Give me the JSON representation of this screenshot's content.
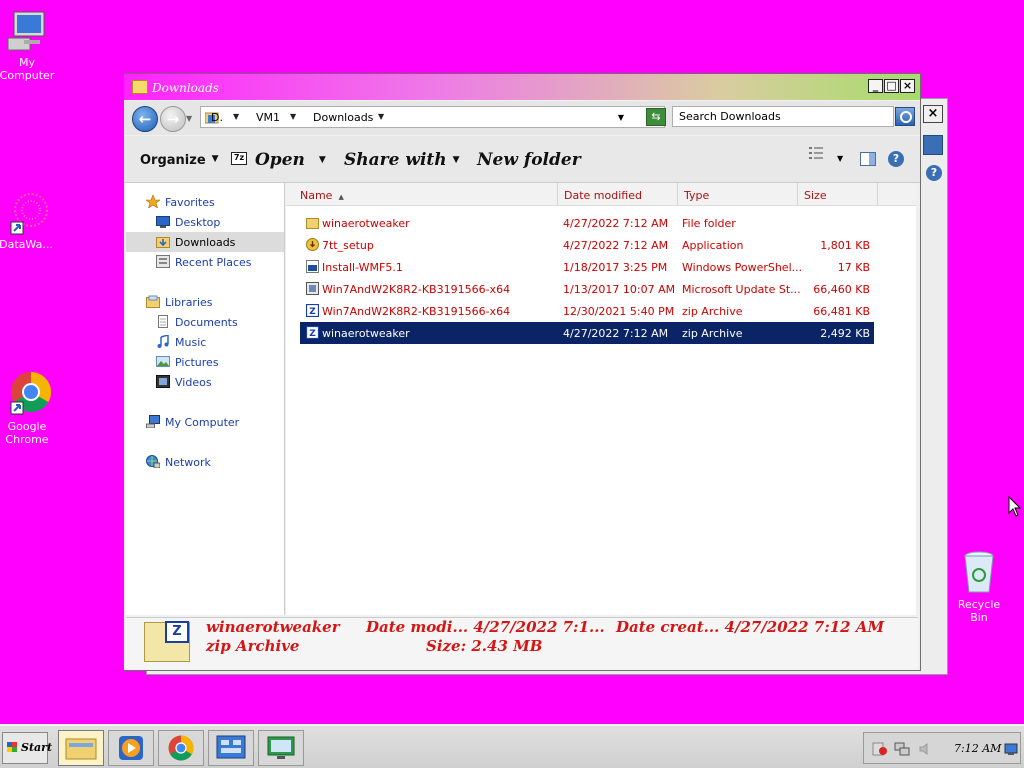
{
  "desktop": {
    "icons": [
      {
        "label": "My\nComputer"
      },
      {
        "label": "DataWa..."
      },
      {
        "label": "Google\nChrome"
      },
      {
        "label": "Recycle\nBin"
      }
    ]
  },
  "window": {
    "title": "Downloads",
    "address": {
      "crumbs": [
        "D.",
        "VM1",
        "Downloads"
      ]
    },
    "search_placeholder": "Search Downloads",
    "commands": {
      "organize": "Organize",
      "open": "Open",
      "share_with": "Share with",
      "new_folder": "New folder",
      "sevenzip_label": "7z"
    },
    "nav": {
      "favorites": "Favorites",
      "desktop": "Desktop",
      "downloads": "Downloads",
      "recent_places": "Recent Places",
      "libraries": "Libraries",
      "documents": "Documents",
      "music": "Music",
      "pictures": "Pictures",
      "videos": "Videos",
      "my_computer": "My Computer",
      "network": "Network"
    },
    "columns": {
      "name": "Name",
      "date_modified": "Date modified",
      "type": "Type",
      "size": "Size"
    },
    "files": [
      {
        "name": "winaerotweaker",
        "date": "4/27/2022 7:12 AM",
        "type": "File folder",
        "size": "",
        "icon": "folder-icon"
      },
      {
        "name": "7tt_setup",
        "date": "4/27/2022 7:12 AM",
        "type": "Application",
        "size": "1,801 KB",
        "icon": "installer-icon"
      },
      {
        "name": "Install-WMF5.1",
        "date": "1/18/2017 3:25 PM",
        "type": "Windows PowerShel...",
        "size": "17 KB",
        "icon": "powershell-script-icon"
      },
      {
        "name": "Win7AndW2K8R2-KB3191566-x64",
        "date": "1/13/2017 10:07 AM",
        "type": "Microsoft Update St...",
        "size": "66,460 KB",
        "icon": "update-package-icon"
      },
      {
        "name": "Win7AndW2K8R2-KB3191566-x64",
        "date": "12/30/2021 5:40 PM",
        "type": "zip Archive",
        "size": "66,481 KB",
        "icon": "zip-icon"
      },
      {
        "name": "winaerotweaker",
        "date": "4/27/2022 7:12 AM",
        "type": "zip Archive",
        "size": "2,492 KB",
        "icon": "zip-icon"
      }
    ],
    "details": {
      "name": "winaerotweaker",
      "type": "zip Archive",
      "date_modified": "Date modi...  4/27/2022 7:1...",
      "size": "Size:  2.43 MB",
      "date_created": "Date creat...  4/27/2022 7:12 AM",
      "badge": "Z"
    }
  },
  "taskbar": {
    "start": "Start",
    "clock": "7:12 AM"
  },
  "colors": {
    "desktop": "#ff00ff",
    "selection": "#0a2466",
    "file_text": "#cc0000",
    "nav_text": "#1a3ea8"
  }
}
